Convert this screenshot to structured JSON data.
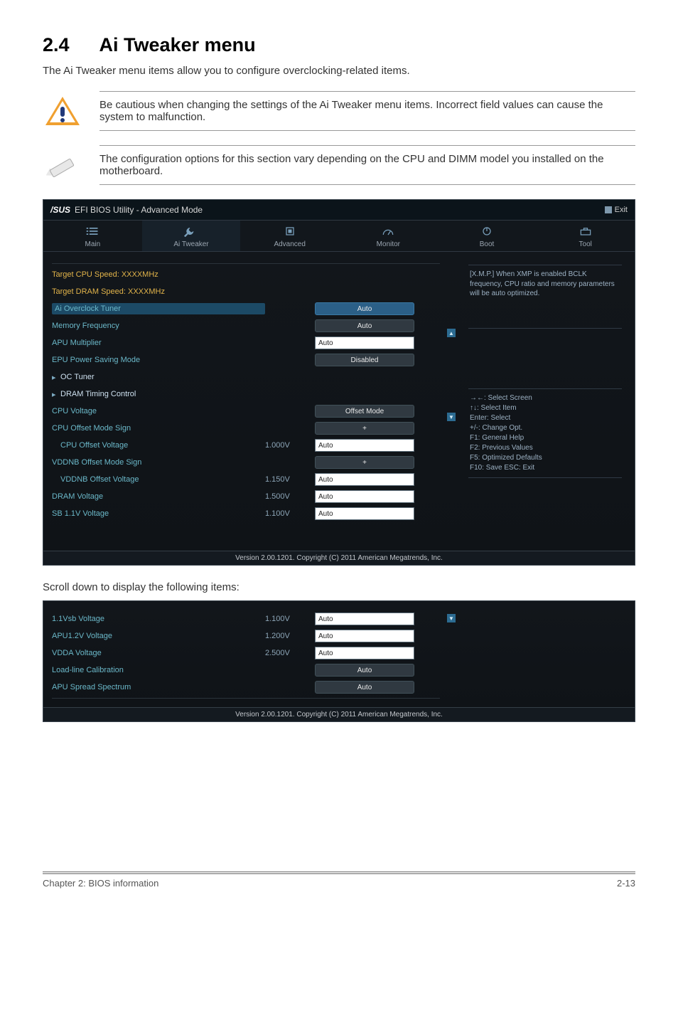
{
  "heading": {
    "num": "2.4",
    "title": "Ai Tweaker menu"
  },
  "intro": "The Ai Tweaker menu items allow you to configure overclocking-related items.",
  "warn_note": "Be cautious when changing the settings of the Ai Tweaker menu items. Incorrect field values can cause the system to malfunction.",
  "info_note": "The configuration options for this section vary depending on the CPU and DIMM model you installed on the motherboard.",
  "bios": {
    "logo": "/SUS",
    "title": "EFI BIOS Utility - Advanced Mode",
    "exit": "Exit",
    "tabs": {
      "main": "Main",
      "ai": "Ai  Tweaker",
      "advanced": "Advanced",
      "monitor": "Monitor",
      "boot": "Boot",
      "tool": "Tool"
    },
    "rows1": {
      "target_cpu": "Target CPU Speed: XXXXMHz",
      "target_dram": "Target DRAM Speed: XXXXMHz",
      "ai_oc": "Ai Overclock Tuner",
      "ai_oc_val": "Auto",
      "mem_freq": "Memory Frequency",
      "mem_freq_val": "Auto",
      "apu_mult": "APU Multiplier",
      "apu_mult_val": "Auto",
      "epu_mode": "EPU Power Saving Mode",
      "epu_mode_val": "Disabled",
      "oc_tuner": "OC Tuner",
      "dram_timing": "DRAM Timing Control",
      "cpu_voltage": "CPU Voltage",
      "cpu_voltage_val": "Offset Mode",
      "cpu_off_sign": "CPU Offset Mode Sign",
      "cpu_off_sign_val": "+",
      "cpu_off_volt": "CPU Offset Voltage",
      "cpu_off_volt_read": "1.000V",
      "cpu_off_volt_val": "Auto",
      "vddnb_sign": "VDDNB Offset Mode Sign",
      "vddnb_sign_val": "+",
      "vddnb_volt": "VDDNB Offset Voltage",
      "vddnb_volt_read": "1.150V",
      "vddnb_volt_val": "Auto",
      "dram_volt": "DRAM Voltage",
      "dram_volt_read": "1.500V",
      "dram_volt_val": "Auto",
      "sb_volt": "SB 1.1V Voltage",
      "sb_volt_read": "1.100V",
      "sb_volt_val": "Auto"
    },
    "help1": "[X.M.P.] When XMP is enabled BCLK frequency, CPU ratio and memory parameters will be auto optimized.",
    "helpkeys": {
      "l1": "→←:  Select Screen",
      "l2": "↑↓:  Select Item",
      "l3": "Enter:  Select",
      "l4": "+/-:  Change Opt.",
      "l5": "F1:  General Help",
      "l6": "F2:  Previous Values",
      "l7": "F5:  Optimized Defaults",
      "l8": "F10:  Save    ESC:  Exit"
    },
    "copyright": "Version  2.00.1201.   Copyright  (C)  2011  American  Megatrends,  Inc.",
    "rows2": {
      "vsb": "1.1Vsb Voltage",
      "vsb_read": "1.100V",
      "vsb_val": "Auto",
      "apu12": "APU1.2V Voltage",
      "apu12_read": "1.200V",
      "apu12_val": "Auto",
      "vdda": "VDDA Voltage",
      "vdda_read": "2.500V",
      "vdda_val": "Auto",
      "llc": "Load-line Calibration",
      "llc_val": "Auto",
      "spread": "APU Spread Spectrum",
      "spread_val": "Auto"
    }
  },
  "scroll_caption": "Scroll down to display the following items:",
  "footer": {
    "left": "Chapter 2: BIOS information",
    "right": "2-13"
  }
}
